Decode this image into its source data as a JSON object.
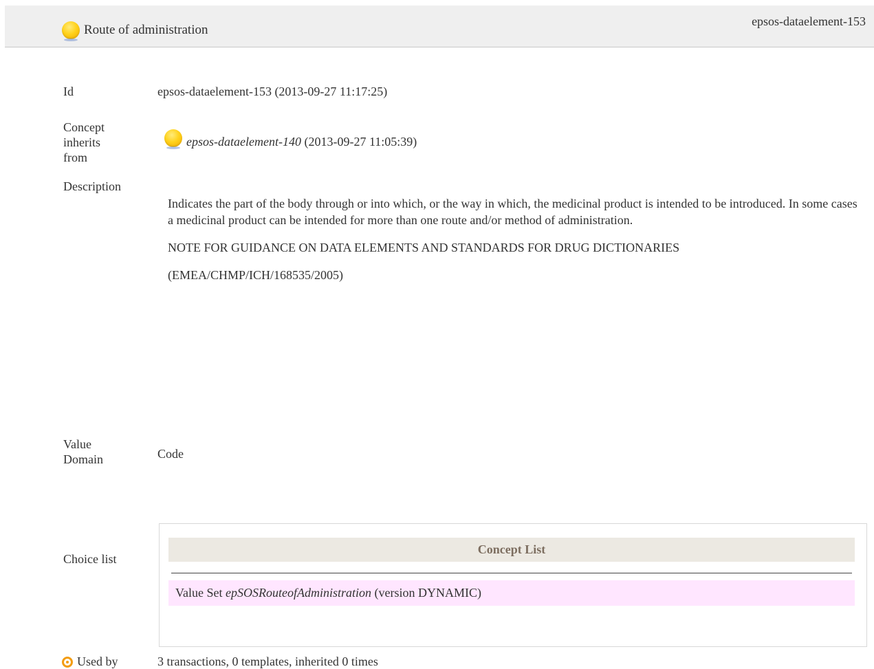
{
  "header": {
    "title": "Route of administration",
    "id": "epsos-dataelement-153"
  },
  "rows": {
    "id": {
      "label": "Id",
      "value": "epsos-dataelement-153 (2013-09-27 11:17:25)"
    },
    "concept": {
      "label": "Concept inherits from",
      "link": "epsos-dataelement-140",
      "date": "(2013-09-27 11:05:39)"
    },
    "description": {
      "label": "Description",
      "paragraphs": [
        "Indicates the part of the body through or into which, or the way in which, the medicinal product is intended to be introduced. In some cases a medicinal product can be intended for more than one route and/or method of administration.",
        "NOTE FOR GUIDANCE ON DATA ELEMENTS AND STANDARDS FOR DRUG DICTIONARIES",
        "(EMEA/CHMP/ICH/168535/2005)"
      ]
    },
    "value_domain": {
      "label": "Value Domain",
      "value": "Code"
    },
    "choice_list": {
      "label": "Choice list",
      "header": "Concept List",
      "row_prefix": "Value Set",
      "row_name": "epSOSRouteofAdministration",
      "row_suffix": "(version DYNAMIC)"
    },
    "used_by": {
      "label": "Used by",
      "value": "3 transactions, 0 templates, inherited 0 times"
    }
  },
  "colors": {
    "header_bg": "#efefef",
    "concept_list_header_bg": "#ece9e2",
    "value_set_row_bg": "#ffe6ff",
    "status_dot": "#ffd21c",
    "target_icon": "#f39c12"
  },
  "icons": {
    "status": "status-dot-icon",
    "used_by": "target-icon"
  }
}
